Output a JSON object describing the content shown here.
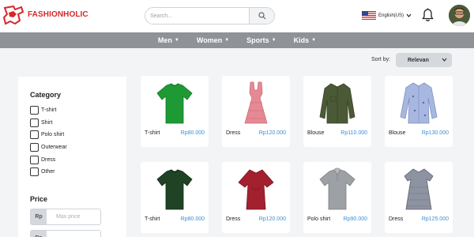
{
  "header": {
    "brand": "FASHIONHOLIC",
    "search_placeholder": "Search...",
    "language": "English(US)"
  },
  "nav": [
    {
      "label": "Men"
    },
    {
      "label": "Women"
    },
    {
      "label": "Sports"
    },
    {
      "label": "Kids"
    }
  ],
  "sort": {
    "label": "Sort by:",
    "value": "Relevan"
  },
  "sidebar": {
    "category_title": "Category",
    "categories": [
      {
        "label": "T-shirt"
      },
      {
        "label": "Shirt"
      },
      {
        "label": "Polo shirt"
      },
      {
        "label": "Outerwear"
      },
      {
        "label": "Dress"
      },
      {
        "label": "Other"
      }
    ],
    "price_title": "Price",
    "currency": "Rp",
    "max_placeholder": "Max price"
  },
  "products": [
    {
      "name": "T-shirt",
      "price": "Rp80.000",
      "icon": "green-tshirt"
    },
    {
      "name": "Dress",
      "price": "Rp120.000",
      "icon": "pink-dress"
    },
    {
      "name": "Blouse",
      "price": "Rp110.000",
      "icon": "olive-blouse"
    },
    {
      "name": "Blouse",
      "price": "Rp130.000",
      "icon": "blue-blouse"
    },
    {
      "name": "T-shirt",
      "price": "Rp80.000",
      "icon": "darkgreen-tshirt"
    },
    {
      "name": "Dress",
      "price": "Rp120.000",
      "icon": "red-dress"
    },
    {
      "name": "Polo shirt",
      "price": "Rp90.000",
      "icon": "grey-polo"
    },
    {
      "name": "Dress",
      "price": "Rp125.000",
      "icon": "patterned-dress"
    }
  ],
  "colors": {
    "brand": "#d6282a",
    "nav_bg": "#8f9296",
    "price": "#3d8fd6"
  }
}
